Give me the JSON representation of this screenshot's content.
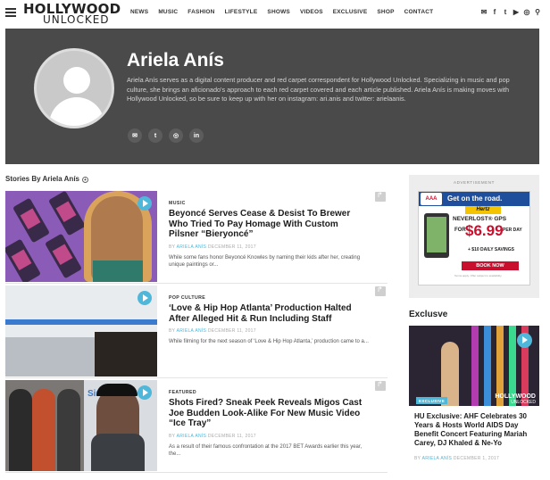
{
  "header": {
    "logo_line1": "HOLLYWOOD",
    "logo_line2": "UNLOCKED",
    "nav": [
      "NEWS",
      "MUSIC",
      "FASHION",
      "LIFESTYLE",
      "SHOWS",
      "VIDEOS",
      "EXCLUSIVE",
      "SHOP",
      "CONTACT"
    ],
    "social_icons": [
      "email-icon",
      "facebook-icon",
      "twitter-icon",
      "youtube-icon",
      "instagram-icon",
      "search-icon"
    ]
  },
  "author": {
    "name": "Ariela Anís",
    "bio": "Ariela Anís serves as a digital content producer and red carpet correspondent for Hollywood Unlocked. Specializing in music and pop culture, she brings an aficionado's approach to each red carpet covered and each article published. Ariela Anís is making moves with Hollywood Unlocked, so be sure to keep up with her on instagram: ari.anis and twitter: arielaanis.",
    "social_icons": [
      "email-icon",
      "twitter-icon",
      "instagram-icon",
      "linkedin-icon"
    ]
  },
  "stories": {
    "title": "Stories By Ariela Anís",
    "items": [
      {
        "category": "MUSIC",
        "headline": "Beyoncé Serves Cease & Desist To Brewer Who Tried To Pay Homage With Custom Pilsner “Bieryoncé”",
        "meta_by": "BY ",
        "meta_author": "ARIELA ANÍS",
        "meta_date": "DECEMBER 11, 2017",
        "excerpt": "While some fans honor Beyoncé Knowles by naming their kids after her, creating unique paintings or..."
      },
      {
        "category": "POP CULTURE",
        "headline": "‘Love & Hip Hop Atlanta’ Production Halted After Alleged Hit & Run Including Staff",
        "meta_by": "BY ",
        "meta_author": "ARIELA ANÍS",
        "meta_date": "DECEMBER 11, 2017",
        "excerpt": "While filming for the next season of ‘Love & Hip Hop Atlanta,’ production came to a..."
      },
      {
        "category": "FEATURED",
        "headline": "Shots Fired? Sneak Peek Reveals Migos Cast Joe Budden Look-Alike For New Music Video “Ice Tray”",
        "meta_by": "BY ",
        "meta_author": "ARIELA ANÍS",
        "meta_date": "DECEMBER 11, 2017",
        "excerpt": "As a result of their famous confrontation at the 2017 BET Awards earlier this year, the..."
      }
    ]
  },
  "sidebar": {
    "ad_label": "ADVERTISEMENT",
    "ad": {
      "aaa": "AAA",
      "headline": "Get on the road.",
      "brand": "Hertz",
      "product": "NEVERLOST® GPS",
      "for": "FOR",
      "price": "$6.99",
      "per_day": "PER DAY",
      "savings": "+ $10 DAILY SAVINGS",
      "cta": "BOOK NOW",
      "fine": "Terms apply. Offer subject to availability."
    },
    "exclusive_title": "Exclusve",
    "exclusive_badge": "EXCLUSIVE",
    "exclusive_watermark": "HOLLYWOOD",
    "exclusive_watermark2": "UNLOCKED",
    "exclusive_headline": "HU Exclusive: AHF Celebrates 30 Years & Hosts World AIDS Day Benefit Concert Featuring Mariah Carey, DJ Khaled & Ne-Yo",
    "exclusive_meta_by": "BY ",
    "exclusive_meta_author": "ARIELA ANÍS",
    "exclusive_meta_date": "DECEMBER 1, 2017"
  },
  "colors": {
    "accent": "#4fb7d9",
    "hero_bg": "#4a4a4a"
  }
}
